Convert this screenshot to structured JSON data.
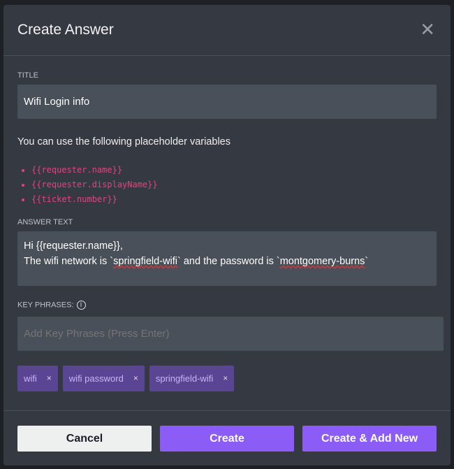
{
  "dialog": {
    "title": "Create Answer",
    "close_icon": "close-icon"
  },
  "title_field": {
    "label": "TITLE",
    "value": "Wifi Login info"
  },
  "placeholders": {
    "hint": "You can use the following placeholder variables",
    "items": [
      "{{requester.name}}",
      "{{requester.displayName}}",
      "{{ticket.number}}"
    ]
  },
  "answer": {
    "label": "ANSWER TEXT",
    "line1": "Hi {{requester.name}},",
    "l2a": "The wifi network is `",
    "l2b": "springfield-wifi",
    "l2c": "` and the password is `",
    "l2d": "montgomery-burns",
    "l2e": "`"
  },
  "key_phrases": {
    "label": "KEY PHRASES:",
    "info_icon": "info-icon",
    "placeholder": "Add Key Phrases (Press Enter)",
    "tags": [
      "wifi",
      "wifi password",
      "springfield-wifi"
    ],
    "remove": "×"
  },
  "buttons": {
    "cancel": "Cancel",
    "create": "Create",
    "create_add": "Create & Add New"
  },
  "colors": {
    "accent": "#8b5cf6",
    "tag_bg": "#5a4595",
    "variable": "#e8407e"
  }
}
